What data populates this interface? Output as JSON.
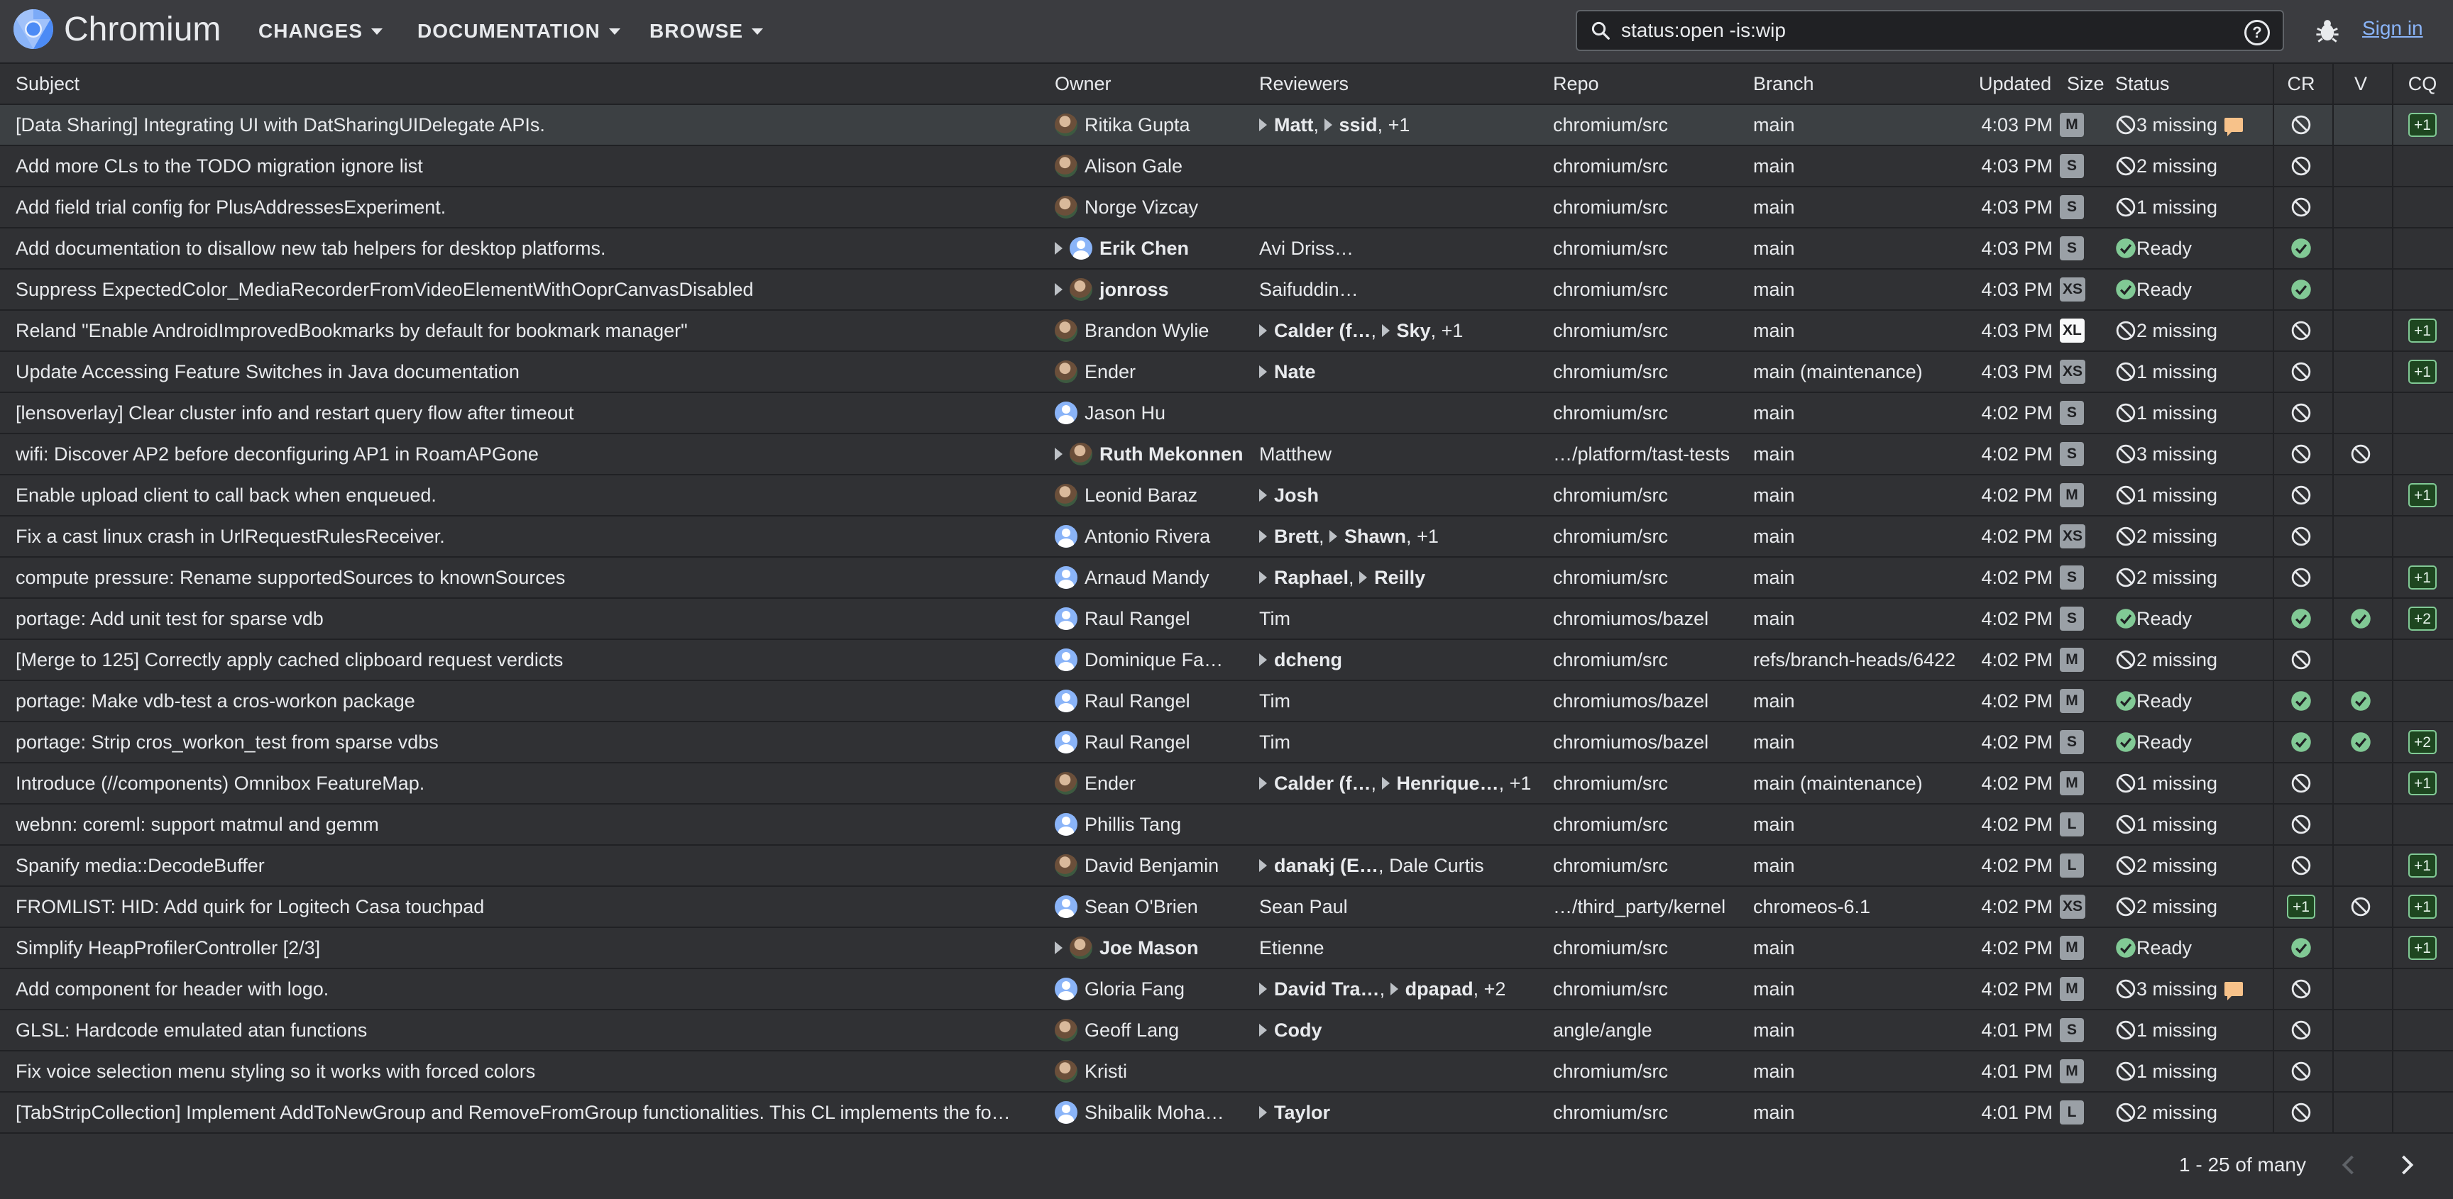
{
  "app": {
    "title": "Chromium"
  },
  "nav": [
    {
      "label": "CHANGES"
    },
    {
      "label": "DOCUMENTATION"
    },
    {
      "label": "BROWSE"
    }
  ],
  "search": {
    "value": "status:open -is:wip",
    "help": "?"
  },
  "header": {
    "sign_in": "Sign in"
  },
  "columns": {
    "subject": "Subject",
    "owner": "Owner",
    "reviewers": "Reviewers",
    "repo": "Repo",
    "branch": "Branch",
    "updated": "Updated",
    "size": "Size",
    "status": "Status",
    "cr": "CR",
    "v": "V",
    "cq": "CQ"
  },
  "rows": [
    {
      "subject": "[Data Sharing] Integrating UI with DatSharingUIDelegate APIs.",
      "owner": "Ritika Gupta",
      "owner_attention": false,
      "owner_avatar": "photo",
      "reviewers": [
        {
          "name": "Matt",
          "attention": true,
          "bold": true
        },
        {
          "name": "ssid",
          "attention": true,
          "bold": true
        }
      ],
      "reviewers_more": "+1",
      "repo": "chromium/src",
      "branch": "main",
      "updated": "4:03 PM",
      "size": "M",
      "status": "3 missing",
      "status_kind": "missing",
      "comment": true,
      "cr": "block",
      "v": "",
      "cq": "+1"
    },
    {
      "subject": "Add more CLs to the TODO migration ignore list",
      "owner": "Alison Gale",
      "owner_attention": false,
      "owner_avatar": "photo",
      "reviewers": [],
      "reviewers_more": "",
      "repo": "chromium/src",
      "branch": "main",
      "updated": "4:03 PM",
      "size": "S",
      "status": "2 missing",
      "status_kind": "missing",
      "comment": false,
      "cr": "block",
      "v": "",
      "cq": ""
    },
    {
      "subject": "Add field trial config for PlusAddressesExperiment.",
      "owner": "Norge Vizcay",
      "owner_attention": false,
      "owner_avatar": "photo",
      "reviewers": [],
      "reviewers_more": "",
      "repo": "chromium/src",
      "branch": "main",
      "updated": "4:03 PM",
      "size": "S",
      "status": "1 missing",
      "status_kind": "missing",
      "comment": false,
      "cr": "block",
      "v": "",
      "cq": ""
    },
    {
      "subject": "Add documentation to disallow new tab helpers for desktop platforms.",
      "owner": "Erik Chen",
      "owner_attention": true,
      "owner_avatar": "gen",
      "reviewers": [
        {
          "name": "Avi Driss…",
          "attention": false,
          "bold": false
        }
      ],
      "reviewers_more": "",
      "repo": "chromium/src",
      "branch": "main",
      "updated": "4:03 PM",
      "size": "S",
      "status": "Ready",
      "status_kind": "ready",
      "comment": false,
      "cr": "ok",
      "v": "",
      "cq": ""
    },
    {
      "subject": "Suppress ExpectedColor_MediaRecorderFromVideoElementWithOoprCanvasDisabled",
      "owner": "jonross",
      "owner_attention": true,
      "owner_avatar": "photo",
      "reviewers": [
        {
          "name": "Saifuddin…",
          "attention": false,
          "bold": false
        }
      ],
      "reviewers_more": "",
      "repo": "chromium/src",
      "branch": "main",
      "updated": "4:03 PM",
      "size": "XS",
      "status": "Ready",
      "status_kind": "ready",
      "comment": false,
      "cr": "ok",
      "v": "",
      "cq": ""
    },
    {
      "subject": "Reland \"Enable AndroidImprovedBookmarks by default for bookmark manager\"",
      "owner": "Brandon Wylie",
      "owner_attention": false,
      "owner_avatar": "photo",
      "reviewers": [
        {
          "name": "Calder (f…",
          "attention": true,
          "bold": true
        },
        {
          "name": "Sky",
          "attention": true,
          "bold": true
        }
      ],
      "reviewers_more": "+1",
      "repo": "chromium/src",
      "branch": "main",
      "updated": "4:03 PM",
      "size": "XL",
      "status": "2 missing",
      "status_kind": "missing",
      "comment": false,
      "cr": "block",
      "v": "",
      "cq": "+1"
    },
    {
      "subject": "Update Accessing Feature Switches in Java documentation",
      "owner": "Ender",
      "owner_attention": false,
      "owner_avatar": "photo",
      "reviewers": [
        {
          "name": "Nate",
          "attention": true,
          "bold": true
        }
      ],
      "reviewers_more": "",
      "repo": "chromium/src",
      "branch": "main (maintenance)",
      "updated": "4:03 PM",
      "size": "XS",
      "status": "1 missing",
      "status_kind": "missing",
      "comment": false,
      "cr": "block",
      "v": "",
      "cq": "+1"
    },
    {
      "subject": "[lensoverlay] Clear cluster info and restart query flow after timeout",
      "owner": "Jason Hu",
      "owner_attention": false,
      "owner_avatar": "gen",
      "reviewers": [],
      "reviewers_more": "",
      "repo": "chromium/src",
      "branch": "main",
      "updated": "4:02 PM",
      "size": "S",
      "status": "1 missing",
      "status_kind": "missing",
      "comment": false,
      "cr": "block",
      "v": "",
      "cq": ""
    },
    {
      "subject": "wifi: Discover AP2 before deconfiguring AP1 in RoamAPGone",
      "owner": "Ruth Mekonnen",
      "owner_attention": true,
      "owner_avatar": "photo",
      "owner_bold": true,
      "reviewers": [
        {
          "name": "Matthew",
          "attention": false,
          "bold": false
        }
      ],
      "reviewers_more": "",
      "repo": "…/platform/tast-tests",
      "branch": "main",
      "updated": "4:02 PM",
      "size": "S",
      "status": "3 missing",
      "status_kind": "missing",
      "comment": false,
      "cr": "block",
      "v": "block",
      "cq": ""
    },
    {
      "subject": "Enable upload client to call back when enqueued.",
      "owner": "Leonid Baraz",
      "owner_attention": false,
      "owner_avatar": "photo",
      "reviewers": [
        {
          "name": "Josh",
          "attention": true,
          "bold": true
        }
      ],
      "reviewers_more": "",
      "repo": "chromium/src",
      "branch": "main",
      "updated": "4:02 PM",
      "size": "M",
      "status": "1 missing",
      "status_kind": "missing",
      "comment": false,
      "cr": "block",
      "v": "",
      "cq": "+1"
    },
    {
      "subject": "Fix a cast linux crash in UrlRequestRulesReceiver.",
      "owner": "Antonio Rivera",
      "owner_attention": false,
      "owner_avatar": "gen",
      "reviewers": [
        {
          "name": "Brett",
          "attention": true,
          "bold": true
        },
        {
          "name": "Shawn",
          "attention": true,
          "bold": true
        }
      ],
      "reviewers_more": "+1",
      "repo": "chromium/src",
      "branch": "main",
      "updated": "4:02 PM",
      "size": "XS",
      "status": "2 missing",
      "status_kind": "missing",
      "comment": false,
      "cr": "block",
      "v": "",
      "cq": ""
    },
    {
      "subject": "compute pressure: Rename supportedSources to knownSources",
      "owner": "Arnaud Mandy",
      "owner_attention": false,
      "owner_avatar": "gen",
      "reviewers": [
        {
          "name": "Raphael",
          "attention": true,
          "bold": true
        },
        {
          "name": "Reilly",
          "attention": true,
          "bold": true
        }
      ],
      "reviewers_more": "",
      "repo": "chromium/src",
      "branch": "main",
      "updated": "4:02 PM",
      "size": "S",
      "status": "2 missing",
      "status_kind": "missing",
      "comment": false,
      "cr": "block",
      "v": "",
      "cq": "+1"
    },
    {
      "subject": "portage: Add unit test for sparse vdb",
      "owner": "Raul Rangel",
      "owner_attention": false,
      "owner_avatar": "gen",
      "reviewers": [
        {
          "name": "Tim",
          "attention": false,
          "bold": false
        }
      ],
      "reviewers_more": "",
      "repo": "chromiumos/bazel",
      "branch": "main",
      "updated": "4:02 PM",
      "size": "S",
      "status": "Ready",
      "status_kind": "ready",
      "comment": false,
      "cr": "ok",
      "v": "ok",
      "cq": "+2"
    },
    {
      "subject": "[Merge to 125] Correctly apply cached clipboard request verdicts",
      "owner": "Dominique Fa…",
      "owner_attention": false,
      "owner_avatar": "gen",
      "reviewers": [
        {
          "name": "dcheng",
          "attention": true,
          "bold": true
        }
      ],
      "reviewers_more": "",
      "repo": "chromium/src",
      "branch": "refs/branch-heads/6422",
      "updated": "4:02 PM",
      "size": "M",
      "status": "2 missing",
      "status_kind": "missing",
      "comment": false,
      "cr": "block",
      "v": "",
      "cq": ""
    },
    {
      "subject": "portage: Make vdb-test a cros-workon package",
      "owner": "Raul Rangel",
      "owner_attention": false,
      "owner_avatar": "gen",
      "reviewers": [
        {
          "name": "Tim",
          "attention": false,
          "bold": false
        }
      ],
      "reviewers_more": "",
      "repo": "chromiumos/bazel",
      "branch": "main",
      "updated": "4:02 PM",
      "size": "M",
      "status": "Ready",
      "status_kind": "ready",
      "comment": false,
      "cr": "ok",
      "v": "ok",
      "cq": ""
    },
    {
      "subject": "portage: Strip cros_workon_test from sparse vdbs",
      "owner": "Raul Rangel",
      "owner_attention": false,
      "owner_avatar": "gen",
      "reviewers": [
        {
          "name": "Tim",
          "attention": false,
          "bold": false
        }
      ],
      "reviewers_more": "",
      "repo": "chromiumos/bazel",
      "branch": "main",
      "updated": "4:02 PM",
      "size": "S",
      "status": "Ready",
      "status_kind": "ready",
      "comment": false,
      "cr": "ok",
      "v": "ok",
      "cq": "+2"
    },
    {
      "subject": "Introduce (//components) Omnibox FeatureMap.",
      "owner": "Ender",
      "owner_attention": false,
      "owner_avatar": "photo",
      "reviewers": [
        {
          "name": "Calder (f…",
          "attention": true,
          "bold": true
        },
        {
          "name": "Henrique…",
          "attention": true,
          "bold": true
        }
      ],
      "reviewers_more": "+1",
      "repo": "chromium/src",
      "branch": "main (maintenance)",
      "updated": "4:02 PM",
      "size": "M",
      "status": "1 missing",
      "status_kind": "missing",
      "comment": false,
      "cr": "block",
      "v": "",
      "cq": "+1"
    },
    {
      "subject": "webnn: coreml: support matmul and gemm",
      "owner": "Phillis Tang",
      "owner_attention": false,
      "owner_avatar": "gen",
      "reviewers": [],
      "reviewers_more": "",
      "repo": "chromium/src",
      "branch": "main",
      "updated": "4:02 PM",
      "size": "L",
      "status": "1 missing",
      "status_kind": "missing",
      "comment": false,
      "cr": "block",
      "v": "",
      "cq": ""
    },
    {
      "subject": "Spanify media::DecodeBuffer",
      "owner": "David Benjamin",
      "owner_attention": false,
      "owner_avatar": "photo",
      "reviewers": [
        {
          "name": "danakj (E…",
          "attention": true,
          "bold": true
        },
        {
          "name": "Dale Curtis",
          "attention": false,
          "bold": false
        }
      ],
      "reviewers_more": "",
      "repo": "chromium/src",
      "branch": "main",
      "updated": "4:02 PM",
      "size": "L",
      "status": "2 missing",
      "status_kind": "missing",
      "comment": false,
      "cr": "block",
      "v": "",
      "cq": "+1"
    },
    {
      "subject": "FROMLIST: HID: Add quirk for Logitech Casa touchpad",
      "owner": "Sean O'Brien",
      "owner_attention": false,
      "owner_avatar": "gen",
      "reviewers": [
        {
          "name": "Sean Paul",
          "attention": false,
          "bold": false
        }
      ],
      "reviewers_more": "",
      "repo": "…/third_party/kernel",
      "branch": "chromeos-6.1",
      "updated": "4:02 PM",
      "size": "XS",
      "status": "2 missing",
      "status_kind": "missing",
      "comment": false,
      "cr": "+1",
      "v": "block",
      "cq": "+1"
    },
    {
      "subject": "Simplify HeapProfilerController [2/3]",
      "owner": "Joe Mason",
      "owner_attention": true,
      "owner_avatar": "photo",
      "owner_bold": true,
      "reviewers": [
        {
          "name": "Etienne",
          "attention": false,
          "bold": false
        }
      ],
      "reviewers_more": "",
      "repo": "chromium/src",
      "branch": "main",
      "updated": "4:02 PM",
      "size": "M",
      "status": "Ready",
      "status_kind": "ready",
      "comment": false,
      "cr": "ok",
      "v": "",
      "cq": "+1"
    },
    {
      "subject": "Add component for header with logo.",
      "owner": "Gloria Fang",
      "owner_attention": false,
      "owner_avatar": "gen",
      "reviewers": [
        {
          "name": "David Tra…",
          "attention": true,
          "bold": true
        },
        {
          "name": "dpapad",
          "attention": true,
          "bold": true
        }
      ],
      "reviewers_more": "+2",
      "repo": "chromium/src",
      "branch": "main",
      "updated": "4:02 PM",
      "size": "M",
      "status": "3 missing",
      "status_kind": "missing",
      "comment": true,
      "cr": "block",
      "v": "",
      "cq": ""
    },
    {
      "subject": "GLSL: Hardcode emulated atan functions",
      "owner": "Geoff Lang",
      "owner_attention": false,
      "owner_avatar": "photo",
      "reviewers": [
        {
          "name": "Cody",
          "attention": true,
          "bold": true
        }
      ],
      "reviewers_more": "",
      "repo": "angle/angle",
      "branch": "main",
      "updated": "4:01 PM",
      "size": "S",
      "status": "1 missing",
      "status_kind": "missing",
      "comment": false,
      "cr": "block",
      "v": "",
      "cq": ""
    },
    {
      "subject": "Fix voice selection menu styling so it works with forced colors",
      "owner": "Kristi",
      "owner_attention": false,
      "owner_avatar": "photo",
      "reviewers": [],
      "reviewers_more": "",
      "repo": "chromium/src",
      "branch": "main",
      "updated": "4:01 PM",
      "size": "M",
      "status": "1 missing",
      "status_kind": "missing",
      "comment": false,
      "cr": "block",
      "v": "",
      "cq": ""
    },
    {
      "subject": "[TabStripCollection] Implement AddToNewGroup and RemoveFromGroup functionalities. This CL implements the fo…",
      "owner": "Shibalik Moha…",
      "owner_attention": false,
      "owner_avatar": "gen",
      "reviewers": [
        {
          "name": "Taylor",
          "attention": true,
          "bold": true
        }
      ],
      "reviewers_more": "",
      "repo": "chromium/src",
      "branch": "main",
      "updated": "4:01 PM",
      "size": "L",
      "status": "2 missing",
      "status_kind": "missing",
      "comment": false,
      "cr": "block",
      "v": "",
      "cq": ""
    }
  ],
  "pagination": {
    "range": "1 - 25 of many"
  }
}
